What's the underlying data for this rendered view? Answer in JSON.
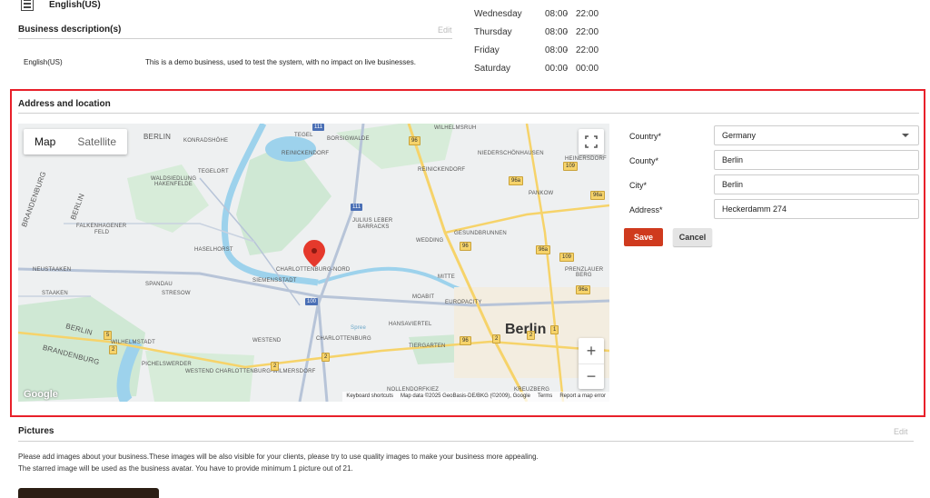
{
  "top": {
    "language_label": "English(US)",
    "business_description_title": "Business description(s)",
    "edit_label": "Edit",
    "description_language": "English(US)",
    "description_text": "This is a demo business, used to test the system, with no impact on live businesses."
  },
  "hours": [
    {
      "day": "Wednesday",
      "open": "08:00",
      "sep": "-",
      "close": "22:00"
    },
    {
      "day": "Thursday",
      "open": "08:00",
      "sep": "-",
      "close": "22:00"
    },
    {
      "day": "Friday",
      "open": "08:00",
      "sep": "-",
      "close": "22:00"
    },
    {
      "day": "Saturday",
      "open": "00:00",
      "sep": "-",
      "close": "00:00"
    }
  ],
  "address": {
    "title": "Address and location",
    "map": {
      "tab_map": "Map",
      "tab_satellite": "Satellite",
      "city_name": "Berlin",
      "google_logo": "Google",
      "attrib_shortcuts": "Keyboard shortcuts",
      "attrib_data": "Map data ©2025 GeoBasis-DE/BKG (©2009), Google",
      "attrib_terms": "Terms",
      "attrib_report": "Report a map error",
      "zoom_in": "+",
      "zoom_out": "−",
      "labels": {
        "berlin_nw": "BERLIN",
        "konradshohe": "KONRADSHÖHE",
        "tegel": "TEGEL",
        "borsigwalde": "BORSIGWALDE",
        "wilhelmsruh": "WILHELMSRUH",
        "reinickendorf": "REINICKENDORF",
        "niederschonhausen": "NIEDERSCHÖNHAUSEN",
        "tegelort": "TEGELORT",
        "waldsiedlung": "WALDSIEDLUNG",
        "hakenfelde": "HAKENFELDE",
        "reinickendorf2": "REINICKENDORF",
        "heinersdorf": "HEINERSDORF",
        "pankow": "PANKOW",
        "brandenburg_top": "BRANDENBURG",
        "berlin_west": "BERLIN",
        "falkenhagener": "FALKENHAGENER",
        "feld": "FELD",
        "julius_leber": "JULIUS LEBER",
        "barracks": "BARRACKS",
        "wedding": "WEDDING",
        "gesundbrunnen": "GESUNDBRUNNEN",
        "haselhorst": "HASELHORST",
        "charlottenburg_nord": "CHARLOTTENBURG-NORD",
        "prenzlauer": "PRENZLAUER",
        "berg": "BERG",
        "neustaaken": "NEUSTAAKEN",
        "siemensstadt": "SIEMENSSTADT",
        "mitte": "MITTE",
        "spandau": "SPANDAU",
        "staaken": "STAAKEN",
        "stresow": "STRESOW",
        "moabit": "MOABIT",
        "europacity": "EUROPACITY",
        "hansaviertel": "HANSAVIERTEL",
        "spree": "Spree",
        "berlin_sw": "BERLIN",
        "wilhelmstadt": "WILHELMSTADT",
        "westend": "WESTEND",
        "charlottenburg": "CHARLOTTENBURG",
        "tiergarten": "TIERGARTEN",
        "brandenburg_bottom": "BRANDENBURG",
        "pichelswerder": "PICHELSWERDER",
        "westend_cw": "WESTEND CHARLOTTENBURG-WILMERSDORF",
        "kreuzberg": "KREUZBERG",
        "nollendorfkiez": "NOLLENDORFKIEZ"
      },
      "shields": [
        "111",
        "96",
        "109",
        "96a",
        "96a",
        "111",
        "96",
        "96a",
        "109",
        "96a",
        "5",
        "2",
        "2",
        "100",
        "96",
        "2",
        "2",
        "1",
        "2"
      ]
    },
    "form": {
      "country_label": "Country*",
      "country_value": "Germany",
      "county_label": "County*",
      "county_value": "Berlin",
      "city_label": "City*",
      "city_value": "Berlin",
      "address_label": "Address*",
      "address_value": "Heckerdamm 274",
      "save_label": "Save",
      "cancel_label": "Cancel"
    }
  },
  "pictures": {
    "title": "Pictures",
    "edit_label": "Edit",
    "line1": "Please add images about your business.These images will be also visible for your clients, please try to use quality images to make your business more appealing.",
    "line2": "The starred image will be used as the business avatar. You have to provide minimum 1 picture out of 21."
  },
  "colors": {
    "highlight_border": "#e8202a",
    "save_button": "#cf3a1e",
    "map_marker": "#e5392c",
    "map_park": "#cfe8d4",
    "map_water": "#9dd2ec",
    "road_highway": "#f6d36a",
    "road_major": "#b7c4d8"
  }
}
